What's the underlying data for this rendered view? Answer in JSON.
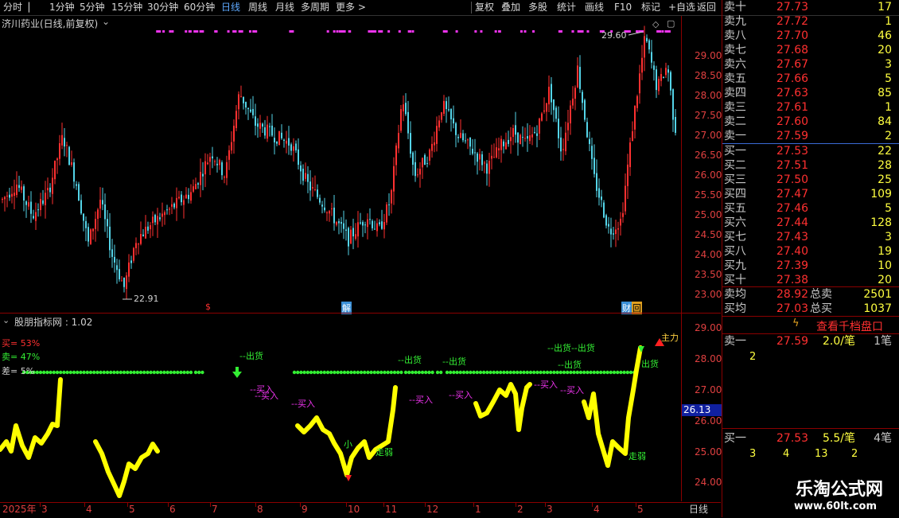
{
  "toolbar": {
    "left": [
      "分时",
      "1分钟",
      "5分钟",
      "15分钟",
      "30分钟",
      "60分钟",
      "日线",
      "周线",
      "月线",
      "多周期",
      "更多 >"
    ],
    "active": "日线",
    "right": [
      "复权",
      "叠加",
      "多股",
      "统计",
      "画线",
      "F10",
      "标记",
      "+自选",
      "返回"
    ]
  },
  "main": {
    "title": "济川药业(日线,前复权)",
    "high_label": "29.60",
    "low_label": "22.91",
    "events": [
      "$",
      "解",
      "财",
      "回"
    ],
    "price_ticks": [
      "29.00",
      "28.50",
      "28.00",
      "27.50",
      "27.00",
      "26.50",
      "26.00",
      "25.50",
      "25.00",
      "24.50",
      "24.00",
      "23.50",
      "23.00"
    ]
  },
  "indicator": {
    "title": "股朋指标网 : 1.02",
    "buy": "买= 53%",
    "sell": "卖= 47%",
    "diff": "差= 5%",
    "ticks": [
      "29.00",
      "28.00",
      "27.00",
      "26.00",
      "25.00",
      "24.00"
    ],
    "cursor_price": "26.13",
    "labels": {
      "out": [
        "--出货",
        "--出货",
        "--出货",
        "--出货",
        "--出货--出货",
        "--出货",
        "出货"
      ],
      "buy": [
        "--买入",
        "--买入",
        "--买入",
        "--买入",
        "--买入",
        "--买入",
        "--买入"
      ],
      "weak": [
        "走弱",
        "走弱"
      ],
      "small": "小",
      "zhuli": "主力"
    }
  },
  "date_axis": [
    "2025年",
    "3",
    "4",
    "5",
    "6",
    "7",
    "8",
    "9",
    "10",
    "11",
    "12",
    "1",
    "2",
    "3",
    "4",
    "5",
    "日线"
  ],
  "book": {
    "asks": [
      {
        "label": "卖十",
        "price": "27.73",
        "vol": "17"
      },
      {
        "label": "卖九",
        "price": "27.72",
        "vol": "1"
      },
      {
        "label": "卖八",
        "price": "27.70",
        "vol": "46"
      },
      {
        "label": "卖七",
        "price": "27.68",
        "vol": "20"
      },
      {
        "label": "卖六",
        "price": "27.67",
        "vol": "3"
      },
      {
        "label": "卖五",
        "price": "27.66",
        "vol": "5"
      },
      {
        "label": "卖四",
        "price": "27.63",
        "vol": "85"
      },
      {
        "label": "卖三",
        "price": "27.61",
        "vol": "1"
      },
      {
        "label": "卖二",
        "price": "27.60",
        "vol": "84"
      },
      {
        "label": "卖一",
        "price": "27.59",
        "vol": "2"
      }
    ],
    "bids": [
      {
        "label": "买一",
        "price": "27.53",
        "vol": "22"
      },
      {
        "label": "买二",
        "price": "27.51",
        "vol": "28"
      },
      {
        "label": "买三",
        "price": "27.50",
        "vol": "25"
      },
      {
        "label": "买四",
        "price": "27.47",
        "vol": "109"
      },
      {
        "label": "买五",
        "price": "27.46",
        "vol": "5"
      },
      {
        "label": "买六",
        "price": "27.44",
        "vol": "128"
      },
      {
        "label": "买七",
        "price": "27.43",
        "vol": "3"
      },
      {
        "label": "买八",
        "price": "27.40",
        "vol": "19"
      },
      {
        "label": "买九",
        "price": "27.39",
        "vol": "10"
      },
      {
        "label": "买十",
        "price": "27.38",
        "vol": "20"
      }
    ],
    "ask_avg_label": "卖均",
    "ask_avg": "28.92",
    "ask_total_label": "总卖",
    "ask_total": "2501",
    "bid_avg_label": "买均",
    "bid_avg": "27.03",
    "bid_total_label": "总买",
    "bid_total": "1037",
    "view_btn": "查看千档盘口",
    "s1_label": "卖一",
    "s1_price": "27.59",
    "s1_per": "2.0/笔",
    "s1_cnt": "1笔",
    "s1_q": "2",
    "b1_label": "买一",
    "b1_price": "27.53",
    "b1_per": "5.5/笔",
    "b1_cnt": "4笔",
    "b1_q": [
      "3",
      "4",
      "13",
      "2"
    ]
  },
  "watermark": {
    "title": "乐淘公式网",
    "url": "www.60lt.com"
  },
  "colors": {
    "up": "#ff3030",
    "down": "#54d4e8",
    "ind": "#ffff00",
    "green": "#33ee33",
    "magenta": "#ee33ee"
  }
}
